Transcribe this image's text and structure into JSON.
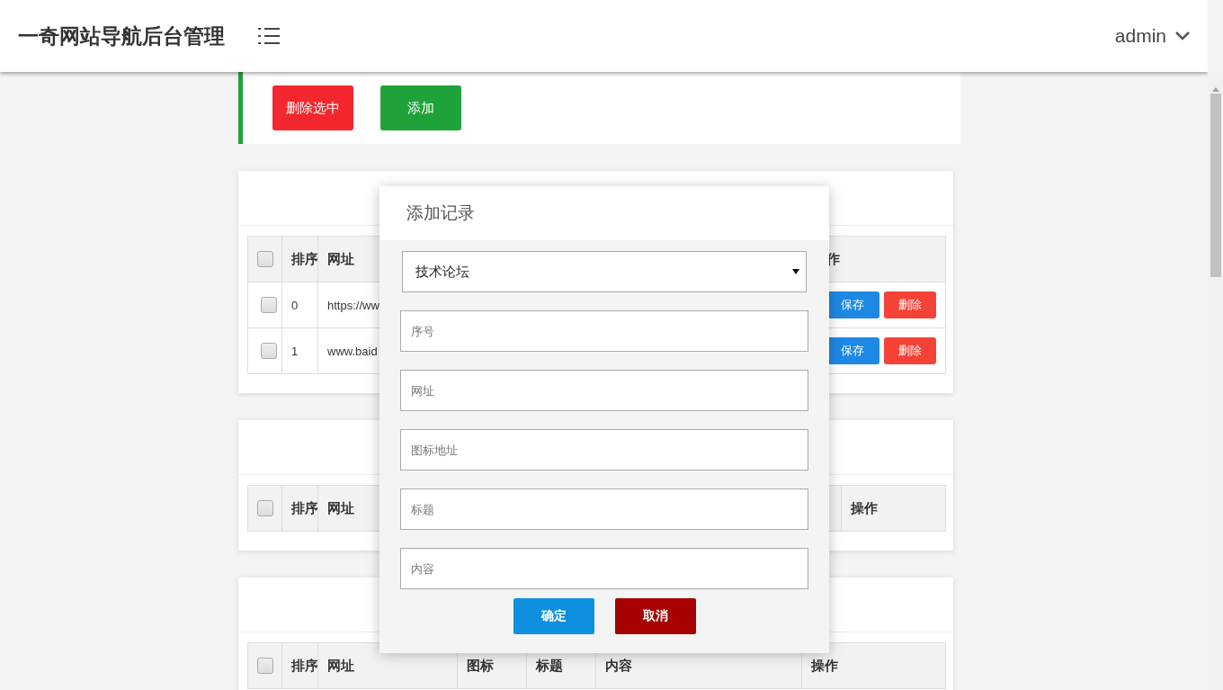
{
  "header": {
    "title": "一奇网站导航后台管理",
    "user": "admin"
  },
  "toolbar": {
    "buttons": [
      {
        "label": "删除选中",
        "kind": "danger"
      },
      {
        "label": "添加",
        "kind": "success"
      }
    ]
  },
  "tables": [
    {
      "columns": [
        {
          "label": "排序"
        },
        {
          "label": "网址"
        },
        {
          "label": "作"
        }
      ],
      "header_checked": false,
      "rows": [
        {
          "checked": false,
          "cells": [
            "0",
            "https://ww"
          ],
          "actions": [
            "保存",
            "删除"
          ]
        },
        {
          "checked": false,
          "cells": [
            "1",
            "www.baid"
          ],
          "actions": [
            "保存",
            "删除"
          ]
        }
      ]
    },
    {
      "columns": [
        {
          "label": "排序"
        },
        {
          "label": "网址"
        },
        {
          "label": "操作"
        }
      ],
      "header_checked": false
    },
    {
      "columns": [
        {
          "label": "排序"
        },
        {
          "label": "网址"
        },
        {
          "label": "图标"
        },
        {
          "label": "标题"
        },
        {
          "label": "内容"
        },
        {
          "label": "操作"
        }
      ],
      "header_checked": false
    }
  ],
  "modal": {
    "title": "添加记录",
    "select": {
      "value": "技术论坛"
    },
    "fields": [
      {
        "placeholder": "序号"
      },
      {
        "placeholder": "网址"
      },
      {
        "placeholder": "图标地址"
      },
      {
        "placeholder": "标题"
      },
      {
        "placeholder": "内容"
      }
    ],
    "buttons": [
      {
        "label": "确定",
        "kind": "confirm"
      },
      {
        "label": "取消",
        "kind": "cancel"
      }
    ]
  }
}
